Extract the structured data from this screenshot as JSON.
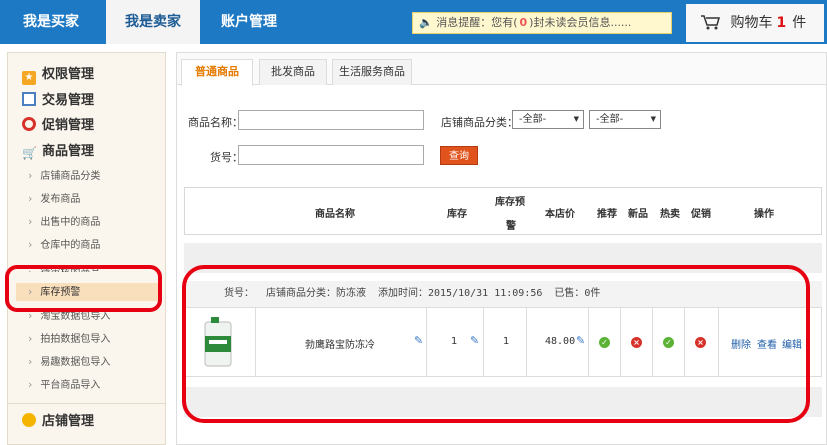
{
  "topnav": {
    "items": [
      "我是买家",
      "我是卖家",
      "账户管理"
    ],
    "active": "我是卖家",
    "message_prefix": "消息提醒：您有(",
    "message_count": "0",
    "message_suffix": ")封未读会员信息......",
    "cart_label": "购物车",
    "cart_count": "1",
    "cart_unit": "件"
  },
  "sidebar": {
    "sections": {
      "perm": "权限管理",
      "trade": "交易管理",
      "promo": "促销管理",
      "goods": "商品管理",
      "shop": "店铺管理"
    },
    "items": [
      "店铺商品分类",
      "发布商品",
      "出售中的商品",
      "仓库中的商品",
      "待审核的商品",
      "库存预警",
      "淘宝数据包导入",
      "拍拍数据包导入",
      "易趣数据包导入",
      "平台商品导入"
    ],
    "active_item": "库存预警"
  },
  "tabs": [
    "普通商品",
    "批发商品",
    "生活服务商品"
  ],
  "search": {
    "name_label": "商品名称：",
    "category_label": "店铺商品分类：",
    "select1": "-全部-",
    "select2": "-全部-",
    "sku_label": "货号：",
    "query_button": "查询"
  },
  "table": {
    "headers": {
      "name": "商品名称",
      "stock": "库存",
      "warn_top": "库存预",
      "warn_bottom": "警",
      "price": "本店价",
      "recommend": "推荐",
      "new": "新品",
      "hot": "热卖",
      "promo": "促销",
      "ops": "操作"
    },
    "info": {
      "sku": "货号：",
      "category": "店铺商品分类：防冻液",
      "added": "添加时间：2015/10/31 11:09:56",
      "sold": "已售：0件"
    },
    "row": {
      "name": "勃鹰路宝防冻冷",
      "stock": "1",
      "warn": "1",
      "price": "48.00",
      "actions": [
        "删除",
        "查看",
        "编辑"
      ]
    }
  },
  "colors": {
    "nav_blue": "#1e79c4",
    "accent_orange": "#e57a00",
    "highlight_red": "#e60012",
    "ok_green": "#5bb335",
    "no_red": "#d6322a"
  }
}
